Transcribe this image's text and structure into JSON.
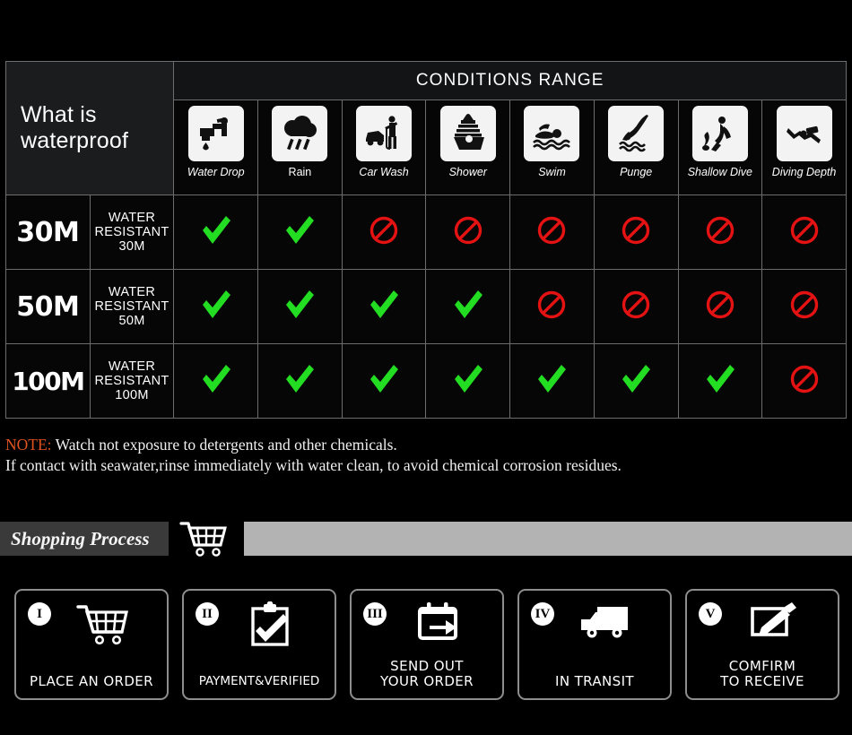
{
  "table": {
    "title": "What is waterproof",
    "conditions_header": "CONDITIONS RANGE",
    "conditions": [
      {
        "label": "Water Drop",
        "icon": "faucet-drop-icon",
        "italic": true
      },
      {
        "label": "Rain",
        "icon": "rain-cloud-icon",
        "italic": false
      },
      {
        "label": "Car Wash",
        "icon": "car-wash-icon",
        "italic": true
      },
      {
        "label": "Shower",
        "icon": "shower-bathtub-icon",
        "italic": true
      },
      {
        "label": "Swim",
        "icon": "swimmer-icon",
        "italic": true
      },
      {
        "label": "Punge",
        "icon": "plunge-diver-icon",
        "italic": true
      },
      {
        "label": "Shallow Dive",
        "icon": "shallow-dive-icon",
        "italic": true
      },
      {
        "label": "Diving Depth",
        "icon": "scuba-diver-icon",
        "italic": true
      }
    ],
    "rows": [
      {
        "depth": "30M",
        "description": "WATER RESISTANT  30M",
        "marks": [
          "check",
          "check",
          "no",
          "no",
          "no",
          "no",
          "no",
          "no"
        ]
      },
      {
        "depth": "50M",
        "description": "WATER RESISTANT 50M",
        "marks": [
          "check",
          "check",
          "check",
          "check",
          "no",
          "no",
          "no",
          "no"
        ]
      },
      {
        "depth": "100M",
        "description": "WATER RESISTANT  100M",
        "marks": [
          "check",
          "check",
          "check",
          "check",
          "check",
          "check",
          "check",
          "no"
        ]
      }
    ]
  },
  "note": {
    "keyword": "NOTE:",
    "line1": "Watch not exposure to detergents and other chemicals.",
    "line2": "If contact with seawater,rinse immediately with water clean, to avoid chemical corrosion residues."
  },
  "shopping": {
    "title": "Shopping Process",
    "cart_icon": "shopping-cart-icon"
  },
  "steps": [
    {
      "numeral": "I",
      "label": "PLACE AN ORDER",
      "icon": "shopping-cart-icon"
    },
    {
      "numeral": "II",
      "label": "PAYMENT&VERIFIED",
      "icon": "clipboard-check-icon"
    },
    {
      "numeral": "III",
      "label": "SEND OUT\nYOUR ORDER",
      "icon": "calendar-arrow-icon"
    },
    {
      "numeral": "IV",
      "label": "IN TRANSIT",
      "icon": "delivery-truck-icon"
    },
    {
      "numeral": "V",
      "label": "COMFIRM\nTO RECEIVE",
      "icon": "edit-pencil-icon"
    }
  ],
  "colors": {
    "check_green": "#22dd22",
    "prohibit_red": "#e41212",
    "note_keyword": "#e0521f",
    "background": "#000000",
    "grid_border": "#6d6d6d"
  }
}
